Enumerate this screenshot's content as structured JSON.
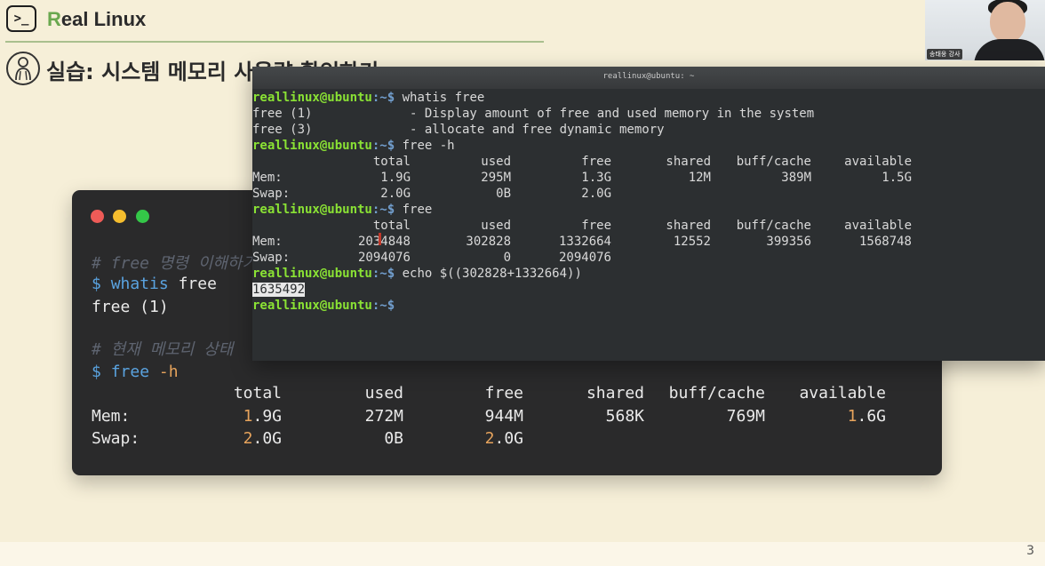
{
  "header": {
    "logo_text": ">_",
    "brand_initial": "R",
    "brand_rest": "eal Linux",
    "slide_title": "실습: 시스템 메모리 사용량 확인하기",
    "page_number": "3"
  },
  "webcam": {
    "name_label": "송태웅 강사"
  },
  "slide_terminal": {
    "comment1": "# free 명령 이해하기",
    "prompt": "$",
    "cmd1": "whatis",
    "cmd1_arg": "free",
    "out1": "free (1)",
    "comment2": "# 현재 메모리 상태",
    "cmd2": "free",
    "cmd2_arg": "-h",
    "headers": [
      "total",
      "used",
      "free",
      "shared",
      "buff/cache",
      "available"
    ],
    "rows": [
      {
        "label": "Mem:",
        "cells": [
          {
            "a": "1",
            ".9G": "",
            "b": ".9G"
          },
          {
            "a": "",
            "b": "272M"
          },
          {
            "a": "",
            "b": "944M"
          },
          {
            "a": "",
            "b": "568K"
          },
          {
            "a": "",
            "b": "769M"
          },
          {
            "a": "1",
            "b": ".6G"
          }
        ]
      },
      {
        "label": "Swap:",
        "cells": [
          {
            "a": "2",
            "b": ".0G"
          },
          {
            "a": "",
            "b": "0B"
          },
          {
            "a": "2",
            "b": ".0G"
          }
        ]
      }
    ]
  },
  "real_terminal": {
    "title": "reallinux@ubuntu: ~",
    "user": "reallinux@ubuntu",
    "path_sep": ":~$",
    "cmd1": " whatis free",
    "whatis_lines": [
      "free (1)             - Display amount of free and used memory in the system",
      "free (3)             - allocate and free dynamic memory"
    ],
    "cmd2": " free -h",
    "headers": [
      "total",
      "used",
      "free",
      "shared",
      "buff/cache",
      "available"
    ],
    "freeh_mem_label": "Mem:",
    "freeh_mem": [
      "1.9G",
      "295M",
      "1.3G",
      "12M",
      "389M",
      "1.5G"
    ],
    "freeh_swap_label": "Swap:",
    "freeh_swap": [
      "2.0G",
      "0B",
      "2.0G"
    ],
    "cmd3": " free",
    "free_mem_label": "Mem:",
    "free_mem": [
      "2034848",
      "302828",
      "1332664",
      "12552",
      "399356",
      "1568748"
    ],
    "free_swap_label": "Swap:",
    "free_swap": [
      "2094076",
      "0",
      "2094076"
    ],
    "cmd4": " echo $((302828+1332664))",
    "echo_result": "1635492"
  },
  "colors": {
    "background": "#f6efd8",
    "brand_accent": "#6aa84f",
    "terminal_user": "#8ae234",
    "terminal_path": "#729fcf",
    "slide_number": "#e6a35c"
  }
}
